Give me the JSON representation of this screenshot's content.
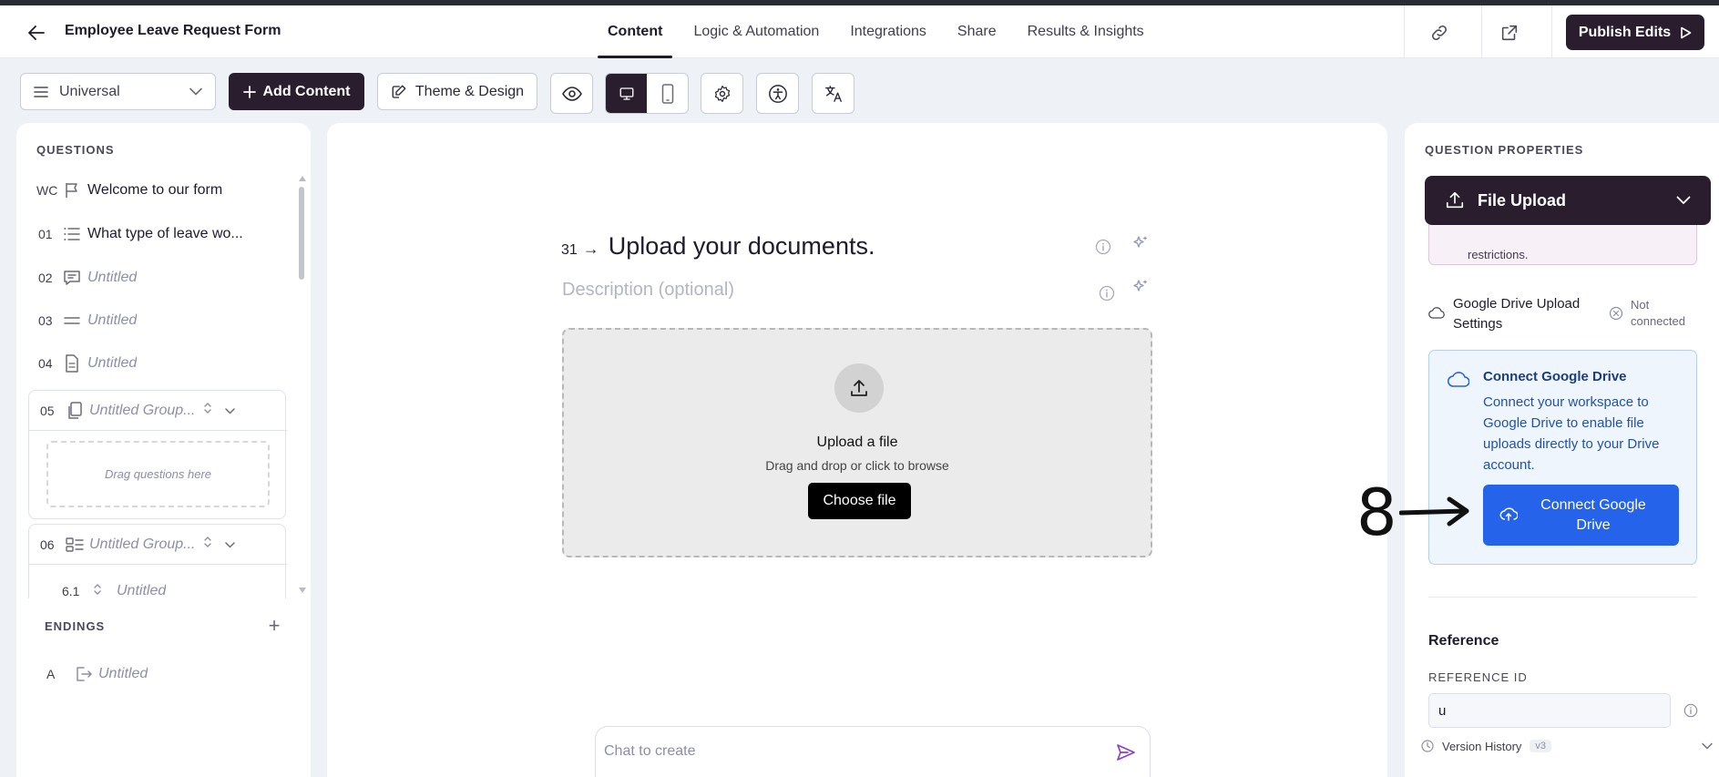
{
  "header": {
    "form_title": "Employee Leave Request Form",
    "tabs": [
      {
        "label": "Content",
        "active": true
      },
      {
        "label": "Logic & Automation"
      },
      {
        "label": "Integrations"
      },
      {
        "label": "Share"
      },
      {
        "label": "Results & Insights"
      }
    ],
    "publish_label": "Publish Edits",
    "icons": [
      "back-arrow-icon",
      "link-icon",
      "external-link-icon",
      "play-icon"
    ]
  },
  "toolbar": {
    "view_select": "Universal",
    "add_content_label": "Add Content",
    "theme_label": "Theme & Design",
    "device_active": "desktop"
  },
  "left": {
    "questions_label": "QUESTIONS",
    "questions": [
      {
        "num": "WC",
        "icon": "flag-icon",
        "text": "Welcome to our form",
        "untitled": false
      },
      {
        "num": "01",
        "icon": "list-icon",
        "text": "What type of leave wo...",
        "untitled": false
      },
      {
        "num": "02",
        "icon": "comment-icon",
        "text": "Untitled",
        "untitled": true
      },
      {
        "num": "03",
        "icon": "lines-icon",
        "text": "Untitled",
        "untitled": true
      },
      {
        "num": "04",
        "icon": "document-icon",
        "text": "Untitled",
        "untitled": true
      }
    ],
    "groups": [
      {
        "num": "05",
        "text": "Untitled Group...",
        "dropzone": "Drag questions here"
      },
      {
        "num": "06",
        "text": "Untitled Group...",
        "child_num": "6.1",
        "child_text": "Untitled"
      }
    ],
    "endings_label": "ENDINGS",
    "ending": {
      "num": "A",
      "text": "Untitled"
    }
  },
  "canvas": {
    "question_num": "31",
    "question_title": "Upload your documents.",
    "description_placeholder": "Description (optional)",
    "upload_title": "Upload a file",
    "upload_sub": "Drag and drop or click to browse",
    "choose_file": "Choose file",
    "chat_placeholder": "Chat to create"
  },
  "right": {
    "properties_label": "QUESTION PROPERTIES",
    "type_label": "File Upload",
    "restrictions_tail": "restrictions.",
    "gd_title": "Google Drive Upload Settings",
    "gd_status": "Not connected",
    "connect_title": "Connect Google Drive",
    "connect_desc": "Connect your workspace to Google Drive to enable file uploads directly to your Drive account.",
    "connect_btn": "Connect Google Drive",
    "reference_title": "Reference",
    "reference_id_label": "REFERENCE ID",
    "reference_id_value": "u",
    "version_history": "Version History",
    "version_badge": "v3"
  },
  "annotation": {
    "number": "8"
  }
}
